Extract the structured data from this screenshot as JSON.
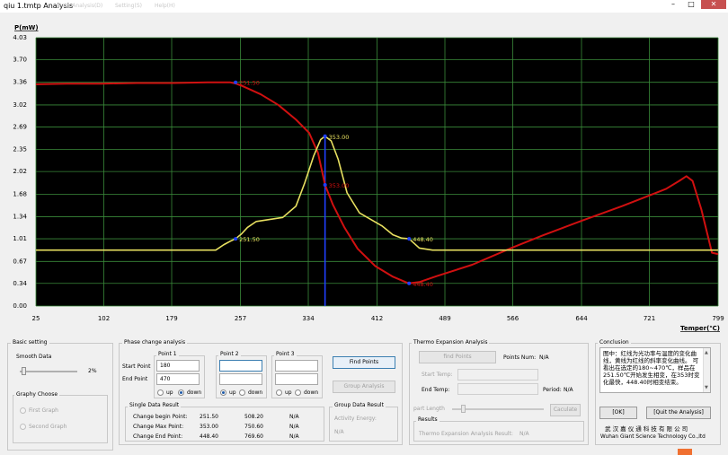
{
  "window": {
    "title": "qiu 1.tmtp  Analysis",
    "menu": [
      "Data Analysis(D)",
      "Setting(S)",
      "Help(H)"
    ],
    "controls": {
      "minimize": "–",
      "maximize": "□",
      "close": "✕"
    }
  },
  "chart_data": {
    "type": "line",
    "ylabel": "P(mW)",
    "xlabel": "Temper(℃)",
    "y_ticks": [
      "0.00",
      "0.34",
      "0.67",
      "1.01",
      "1.34",
      "1.68",
      "2.02",
      "2.35",
      "2.69",
      "3.02",
      "3.36",
      "3.70",
      "4.03"
    ],
    "x_ticks": [
      "25",
      "102",
      "179",
      "257",
      "334",
      "412",
      "489",
      "566",
      "644",
      "721",
      "799"
    ],
    "xlim": [
      25,
      799
    ],
    "ylim": [
      0,
      4.03
    ],
    "grid": true,
    "background": "#000000",
    "series": [
      {
        "color": "#d01010",
        "x": [
          25,
          60,
          100,
          140,
          180,
          220,
          245,
          252,
          260,
          280,
          300,
          320,
          335,
          345,
          353,
          362,
          375,
          390,
          410,
          430,
          448,
          460,
          480,
          520,
          566,
          600,
          644,
          690,
          721,
          740,
          755,
          763,
          770,
          780,
          792,
          799
        ],
        "y": [
          3.33,
          3.34,
          3.34,
          3.35,
          3.35,
          3.36,
          3.36,
          3.34,
          3.3,
          3.18,
          3.02,
          2.8,
          2.6,
          2.3,
          1.82,
          1.52,
          1.18,
          0.86,
          0.6,
          0.44,
          0.34,
          0.36,
          0.45,
          0.62,
          0.88,
          1.06,
          1.28,
          1.5,
          1.66,
          1.76,
          1.88,
          1.95,
          1.88,
          1.45,
          0.8,
          0.78
        ]
      },
      {
        "color": "#e8e060",
        "x": [
          25,
          60,
          100,
          140,
          180,
          229,
          238,
          245,
          251.5,
          258,
          265,
          275,
          290,
          305,
          320,
          330,
          340,
          348,
          353,
          360,
          368,
          378,
          392,
          405,
          418,
          430,
          440,
          448.4,
          460,
          475,
          520,
          600,
          700,
          799
        ],
        "y": [
          0.84,
          0.84,
          0.84,
          0.84,
          0.84,
          0.84,
          0.92,
          0.97,
          1.01,
          1.08,
          1.18,
          1.27,
          1.3,
          1.33,
          1.5,
          1.85,
          2.25,
          2.5,
          2.55,
          2.48,
          2.2,
          1.7,
          1.4,
          1.3,
          1.2,
          1.07,
          1.02,
          1.01,
          0.87,
          0.84,
          0.84,
          0.84,
          0.84,
          0.84
        ]
      }
    ],
    "annotations": [
      {
        "x": 251.5,
        "y": 3.36,
        "text": "251.50",
        "color": "#d01010"
      },
      {
        "x": 353,
        "y": 2.55,
        "text": "353.00",
        "color": "#e8e060"
      },
      {
        "x": 353,
        "y": 1.82,
        "text": "353.00",
        "color": "#d01010"
      },
      {
        "x": 251.5,
        "y": 1.01,
        "text": "251.50",
        "color": "#e8e060"
      },
      {
        "x": 448.4,
        "y": 1.01,
        "text": "448.40",
        "color": "#e8e060"
      },
      {
        "x": 448.4,
        "y": 0.34,
        "text": "448.40",
        "color": "#d01010"
      }
    ],
    "marker_line_x": 353,
    "marker_line_color": "#2040ff"
  },
  "basic_setting": {
    "title": "Basic setting",
    "smooth_label": "Smooth Data",
    "smooth_value": "2%",
    "smooth_level": 0.02,
    "graphy_title": "Graphy Choose",
    "first_graph": "First Graph",
    "second_graph": "Second Graph"
  },
  "phase": {
    "title": "Phase change analysis",
    "start_label": "Start Point",
    "end_label": "End Point",
    "points": [
      {
        "title": "Point 1",
        "start": "180",
        "end": "470",
        "up": "up",
        "down": "down",
        "selected": "down"
      },
      {
        "title": "Point 2",
        "start": "",
        "end": "",
        "up": "up",
        "down": "down",
        "selected": "up"
      },
      {
        "title": "Point 3",
        "start": "",
        "end": "",
        "up": "up",
        "down": "down",
        "selected": "none"
      }
    ],
    "find_points": "Find Points",
    "group_analysis": "Group Analysis",
    "single_title": "Single Data Result",
    "rows": [
      {
        "label": "Change begin Point:",
        "v1": "251.50",
        "v2": "508.20",
        "v3": "N/A"
      },
      {
        "label": "Change Max Point:",
        "v1": "353.00",
        "v2": "750.60",
        "v3": "N/A"
      },
      {
        "label": "Change End Point:",
        "v1": "448.40",
        "v2": "769.60",
        "v3": "N/A"
      }
    ],
    "group_title": "Group Data Result",
    "activity_label": "Activity Energy:",
    "activity_value": "N/A"
  },
  "thermo": {
    "title": "Thermo Expansion Analysis",
    "find_points": "find Points",
    "points_num_label": "Points Num:",
    "points_num_value": "N/A",
    "start_temp": "Start Temp:",
    "end_temp": "End Temp:",
    "period_label": "Period:",
    "period_value": "N/A",
    "part_length": "part Length",
    "calculate": "Caculate",
    "results_title": "Results",
    "result_label": "Thermo Expansion Analysis Result:",
    "result_value": "N/A"
  },
  "conclusion": {
    "title": "Conclusion",
    "text": "图中：红线为光功率与温度的变化曲线，黄线为红线的斜率变化曲线。 可看出在选定的180~470℃，样品在251.50℃开始发生相变，在353时变化最快，448.40时相变结束。",
    "ok": "[OK]",
    "quit": "[Quit the Analysis]",
    "company_cn": "武 汉 嘉 仪 通 科 技 有 限 公 司",
    "company_en": "Wuhan Giant Science  Technology Co.,ltd"
  }
}
